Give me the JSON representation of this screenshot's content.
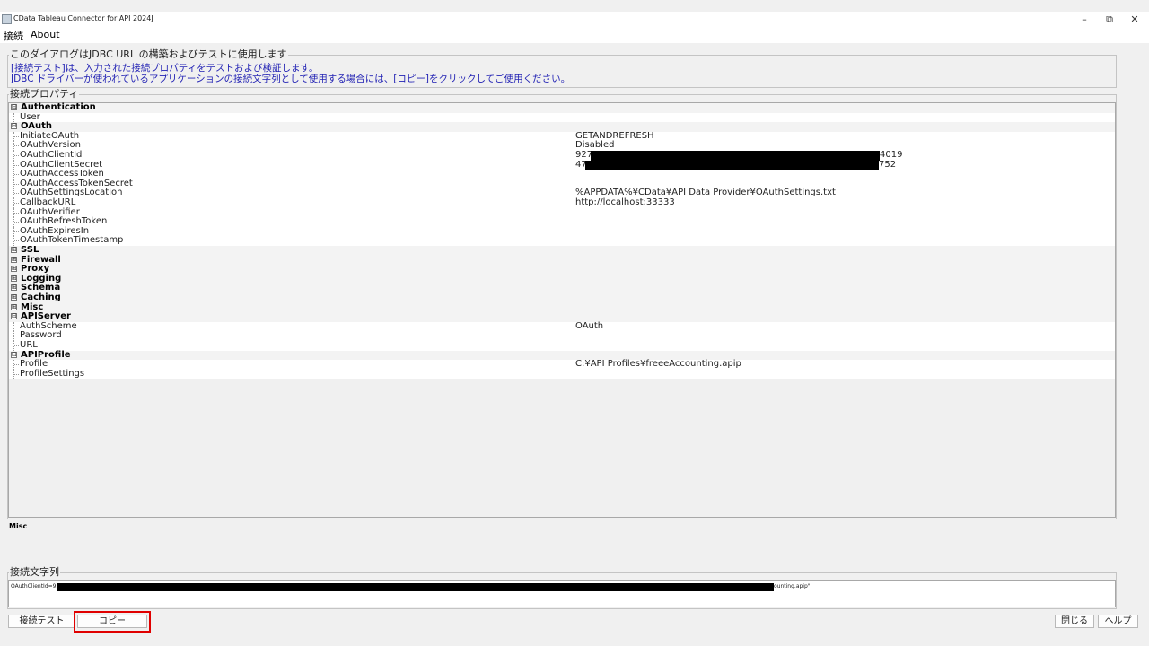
{
  "window": {
    "title": "CData Tableau Connector for API 2024J",
    "minimize_icon": "–",
    "maximize_icon": "⧉",
    "close_icon": "✕"
  },
  "menu": {
    "items": [
      "接続",
      "About"
    ]
  },
  "info": {
    "legend": "このダイアログはJDBC URL の構築およびテストに使用します",
    "line1": "[接続テスト]は、入力された接続プロパティをテストおよび検証します。",
    "line2": "JDBC ドライバーが使われているアプリケーションの接続文字列として使用する場合には、[コピー]をクリックしてご使用ください。"
  },
  "properties": {
    "legend": "接続プロパティ",
    "rows": [
      {
        "type": "cat",
        "toggle": "⊟",
        "name": "Authentication"
      },
      {
        "type": "prop",
        "name": "User",
        "value": ""
      },
      {
        "type": "cat",
        "toggle": "⊟",
        "name": "OAuth"
      },
      {
        "type": "prop",
        "name": "InitiateOAuth",
        "value": "GETANDREFRESH"
      },
      {
        "type": "prop",
        "name": "OAuthVersion",
        "value": "Disabled"
      },
      {
        "type": "prop",
        "name": "OAuthClientId",
        "value": "927",
        "value_tail": "4019"
      },
      {
        "type": "prop",
        "name": "OAuthClientSecret",
        "value": "47",
        "value_tail": "752"
      },
      {
        "type": "prop",
        "name": "OAuthAccessToken",
        "value": ""
      },
      {
        "type": "prop",
        "name": "OAuthAccessTokenSecret",
        "value": ""
      },
      {
        "type": "prop",
        "name": "OAuthSettingsLocation",
        "value": "%APPDATA%¥CData¥API Data Provider¥OAuthSettings.txt"
      },
      {
        "type": "prop",
        "name": "CallbackURL",
        "value": "http://localhost:33333"
      },
      {
        "type": "prop",
        "name": "OAuthVerifier",
        "value": ""
      },
      {
        "type": "prop",
        "name": "OAuthRefreshToken",
        "value": ""
      },
      {
        "type": "prop",
        "name": "OAuthExpiresIn",
        "value": ""
      },
      {
        "type": "prop",
        "name": "OAuthTokenTimestamp",
        "value": ""
      },
      {
        "type": "cat",
        "toggle": "⊞",
        "name": "SSL"
      },
      {
        "type": "cat",
        "toggle": "⊞",
        "name": "Firewall"
      },
      {
        "type": "cat",
        "toggle": "⊞",
        "name": "Proxy"
      },
      {
        "type": "cat",
        "toggle": "⊞",
        "name": "Logging"
      },
      {
        "type": "cat",
        "toggle": "⊞",
        "name": "Schema"
      },
      {
        "type": "cat",
        "toggle": "⊞",
        "name": "Caching"
      },
      {
        "type": "cat",
        "toggle": "⊞",
        "name": "Misc"
      },
      {
        "type": "cat",
        "toggle": "⊟",
        "name": "APIServer"
      },
      {
        "type": "prop",
        "name": "AuthScheme",
        "value": "OAuth"
      },
      {
        "type": "prop",
        "name": "Password",
        "value": ""
      },
      {
        "type": "prop",
        "name": "URL",
        "value": ""
      },
      {
        "type": "cat",
        "toggle": "⊟",
        "name": "APIProfile"
      },
      {
        "type": "prop",
        "name": "Profile",
        "value": "C:¥API Profiles¥freeeAccounting.apip"
      },
      {
        "type": "prop",
        "name": "ProfileSettings",
        "value": ""
      }
    ]
  },
  "description": {
    "title": "Misc"
  },
  "connection_string": {
    "legend": "接続文字列",
    "text_head": "OAuthClientId=92",
    "text_tail": "ounting.apip\""
  },
  "buttons": {
    "test": "接続テスト",
    "copy": "コピー",
    "close": "閉じる",
    "help": "ヘルプ"
  },
  "colors": {
    "info_text": "#2323b4",
    "highlight": "#e00000"
  }
}
